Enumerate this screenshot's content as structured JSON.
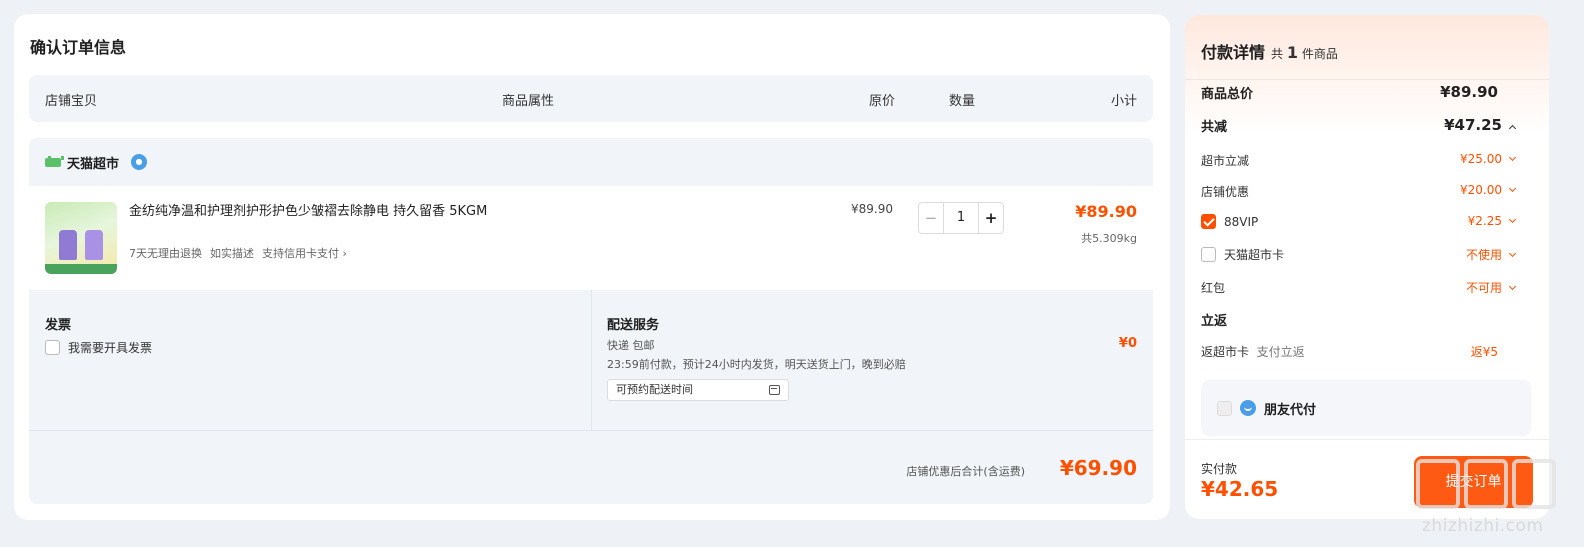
{
  "order": {
    "title": "确认订单信息",
    "columns": {
      "item": "店铺宝贝",
      "attrs": "商品属性",
      "price": "原价",
      "qty": "数量",
      "subtotal": "小计"
    },
    "store": {
      "name": "天猫超市",
      "item": {
        "title": "金纺纯净温和护理剂护形护色少皱褶去除静电 持久留香 5KGM",
        "tags": [
          "7天无理由退换",
          "如实描述",
          "支持信用卡支付 ›"
        ],
        "unit_price": "¥89.90",
        "qty": "1",
        "subtotal": "¥89.90",
        "weight": "共5.309kg"
      },
      "invoice": {
        "title": "发票",
        "option": "我需要开具发票"
      },
      "shipping": {
        "title": "配送服务",
        "method": "快递 包邮",
        "desc": "23:59前付款，预计24小时内发货，明天送货上门，晚到必赔",
        "fee": "¥0",
        "time_picker": "可预约配送时间"
      },
      "total_label": "店铺优惠后合计(含运费)",
      "total": "¥69.90"
    }
  },
  "payment": {
    "title": "付款详情",
    "count_prefix": "共",
    "count": "1",
    "count_suffix": "件商品",
    "goods_total": {
      "label": "商品总价",
      "value": "¥89.90"
    },
    "discount_total": {
      "label": "共减",
      "value": "¥47.25"
    },
    "discounts": [
      {
        "label": "超市立减",
        "value": "¥25.00"
      },
      {
        "label": "店铺优惠",
        "value": "¥20.00"
      },
      {
        "label": "88VIP",
        "value": "¥2.25",
        "checked": true
      },
      {
        "label": "天猫超市卡",
        "value": "不使用",
        "checked": false
      },
      {
        "label": "红包",
        "value": "不可用"
      }
    ],
    "rebate_title": "立返",
    "rebate": {
      "label": "返超市卡",
      "sub": "支付立返",
      "value": "返¥5"
    },
    "friend_pay": "朋友代付",
    "actual_label": "实付款",
    "actual_total": "¥42.65",
    "submit": "提交订单"
  },
  "watermark": "zhizhizhi.com"
}
